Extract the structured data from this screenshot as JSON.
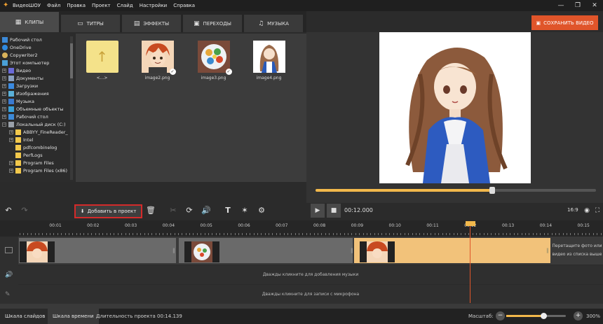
{
  "menubar": {
    "app_name": "ВидеоШОУ",
    "items": [
      "Файл",
      "Правка",
      "Проект",
      "Слайд",
      "Настройки",
      "Справка"
    ]
  },
  "tabs": [
    {
      "label": "КЛИПЫ",
      "icon": "clips-icon",
      "active": true
    },
    {
      "label": "ТИТРЫ",
      "icon": "titles-icon",
      "active": false
    },
    {
      "label": "ЭФФЕКТЫ",
      "icon": "effects-icon",
      "active": false
    },
    {
      "label": "ПЕРЕХОДЫ",
      "icon": "transitions-icon",
      "active": false
    },
    {
      "label": "МУЗЫКА",
      "icon": "music-icon",
      "active": false
    }
  ],
  "save_button": "СОХРАНИТЬ ВИДЕО",
  "tree": [
    {
      "label": "Рабочий стол",
      "level": 0,
      "icon": "desktop"
    },
    {
      "label": "OneDrive",
      "level": 0,
      "icon": "cloud"
    },
    {
      "label": "Copywriter2",
      "level": 0,
      "icon": "user"
    },
    {
      "label": "Этот компьютер",
      "level": 0,
      "icon": "computer"
    },
    {
      "label": "Видео",
      "level": 1,
      "icon": "video"
    },
    {
      "label": "Документы",
      "level": 1,
      "icon": "docs"
    },
    {
      "label": "Загрузки",
      "level": 1,
      "icon": "download"
    },
    {
      "label": "Изображения",
      "level": 1,
      "icon": "images"
    },
    {
      "label": "Музыка",
      "level": 1,
      "icon": "music"
    },
    {
      "label": "Объемные объекты",
      "level": 1,
      "icon": "3d"
    },
    {
      "label": "Рабочий стол",
      "level": 1,
      "icon": "desktop"
    },
    {
      "label": "Локальный диск (C:)",
      "level": 1,
      "icon": "disk"
    },
    {
      "label": "ABBYY_FineReader_",
      "level": 2,
      "icon": "folder"
    },
    {
      "label": "Intel",
      "level": 2,
      "icon": "folder"
    },
    {
      "label": "pdfcombinelog",
      "level": 2,
      "icon": "folder"
    },
    {
      "label": "PerfLogs",
      "level": 2,
      "icon": "folder"
    },
    {
      "label": "Program Files",
      "level": 2,
      "icon": "folder"
    },
    {
      "label": "Program Files (x86)",
      "level": 2,
      "icon": "folder"
    }
  ],
  "files": [
    {
      "name": "<...>",
      "kind": "up-folder",
      "checked": false
    },
    {
      "name": "image2.png",
      "kind": "boy",
      "checked": true
    },
    {
      "name": "image3.png",
      "kind": "food",
      "checked": true
    },
    {
      "name": "image4.png",
      "kind": "girl",
      "checked": false
    }
  ],
  "toolbar": {
    "add_to_project": "Добавить в проект"
  },
  "player": {
    "time": "00:12.000",
    "ratio": "16:9",
    "progress": 0.63
  },
  "ruler": [
    "00:01",
    "00:02",
    "00:03",
    "00:04",
    "00:05",
    "00:06",
    "00:07",
    "00:08",
    "00:09",
    "00:10",
    "00:11",
    "00:12",
    "00:13",
    "00:14",
    "00:15"
  ],
  "timeline": {
    "drop_hint": "Перетащите фото или видео из списка выше",
    "music_hint": "Дважды кликните для добавления музыки",
    "mic_hint": "Дважды кликните для записи с микрофона"
  },
  "status": {
    "tab_slides": "Шкала слайдов",
    "tab_timeline": "Шкала времени",
    "duration": "Длительность проекта 00:14.139",
    "zoom_label": "Масштаб:",
    "zoom_value": "300%",
    "zoom_level": 0.62
  },
  "colors": {
    "accent": "#e0552a",
    "selection": "#f2b84b",
    "highlight_border": "#d42a2a"
  }
}
